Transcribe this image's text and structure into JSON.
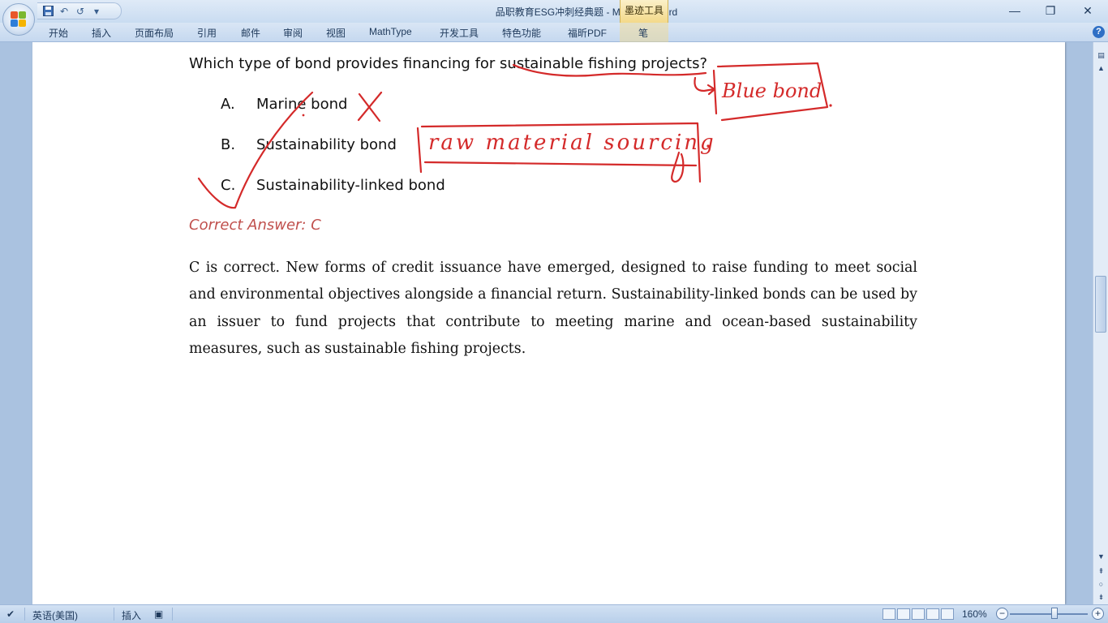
{
  "window": {
    "title": "品职教育ESG冲刺经典题 - Microsoft Word",
    "contextual_tab": "墨迹工具",
    "controls": {
      "minimize": "—",
      "restore": "❐",
      "close": "✕"
    }
  },
  "qat": {
    "undo": "↶",
    "redo": "↺",
    "more": "▾"
  },
  "ribbon": {
    "tabs": [
      "开始",
      "插入",
      "页面布局",
      "引用",
      "邮件",
      "审阅",
      "视图",
      "MathType",
      "开发工具",
      "特色功能",
      "福昕PDF",
      "笔"
    ],
    "help": "?"
  },
  "document": {
    "question": "Which type of bond provides financing for sustainable fishing projects?",
    "options": [
      {
        "letter": "A.",
        "text": "Marine bond"
      },
      {
        "letter": "B.",
        "text": "Sustainability bond"
      },
      {
        "letter": "C.",
        "text": "Sustainability-linked bond"
      }
    ],
    "answer": "Correct Answer:  C",
    "explanation": "C is correct. New forms of credit issuance have emerged, designed to raise funding to meet social and environmental objectives alongside a financial return. Sustainability-linked bonds can be used by an issuer to fund projects that contribute to meeting marine and ocean-based sustainability measures, such as sustainable fishing projects.",
    "ink_notes": {
      "blue_bond_note": "Blue bond",
      "raw_material_note": "raw material sourcing",
      "ink_color": "#d42a2a"
    }
  },
  "statusbar": {
    "language": "英语(美国)",
    "insert_mode": "插入",
    "zoom": "160%",
    "zoom_out": "−",
    "zoom_in": "+"
  }
}
